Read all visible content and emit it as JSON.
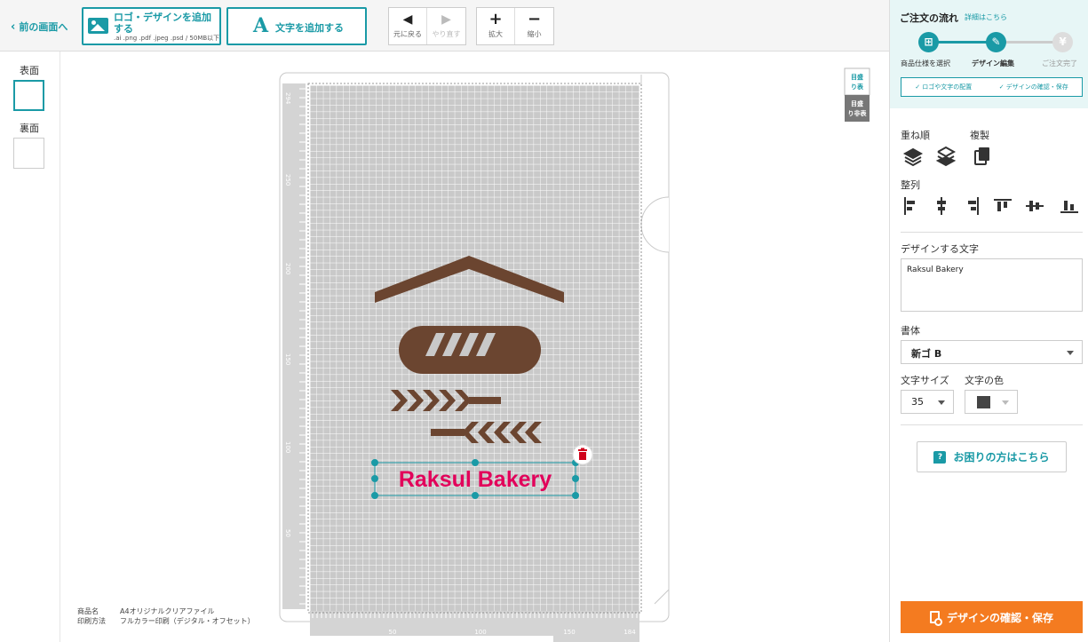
{
  "toolbar": {
    "back_label": "前の画面へ",
    "logo_button": {
      "line1": "ロゴ・デザインを追加する",
      "formats": ".ai .png .pdf .jpeg .psd / 50MB以下"
    },
    "text_button": {
      "icon": "A",
      "label": "文字を追加する"
    },
    "undo": "元に戻る",
    "redo": "やり直す",
    "zoom_in": "拡大",
    "zoom_out": "縮小"
  },
  "sides": {
    "front": "表面",
    "back": "裏面"
  },
  "canvas": {
    "ruler_v": [
      "294",
      "250",
      "200",
      "150",
      "100",
      "50"
    ],
    "ruler_h": [
      "50",
      "100",
      "150",
      "184"
    ],
    "guide_show": "目盛り表示",
    "guide_hide": "目盛り非表示",
    "selected_text": "Raksul Bakery",
    "selected_text_color": "#e2005a"
  },
  "product": {
    "name_label": "商品名",
    "name_value": "A4オリジナルクリアファイル",
    "print_label": "印刷方法",
    "print_value": "フルカラー印刷（デジタル・オフセット）"
  },
  "panel": {
    "flow_title": "ご注文の流れ",
    "flow_detail": "詳細はこちら",
    "steps": [
      {
        "label": "商品仕様を選択",
        "icon": "gift-icon"
      },
      {
        "label": "デザイン編集",
        "icon": "pencil-icon"
      },
      {
        "label": "ご注文完了",
        "icon": "yen-icon"
      }
    ],
    "substeps": [
      "✓ ロゴや文字の配置",
      "✓ デザインの確認・保存"
    ],
    "order_label": "重ね順",
    "duplicate_label": "複製",
    "align_label": "整列",
    "text_label": "デザインする文字",
    "text_value": "Raksul Bakery",
    "font_label": "書体",
    "font_value": "新ゴ B",
    "size_label": "文字サイズ",
    "size_value": "35",
    "color_label": "文字の色",
    "color_value": "#444444",
    "help_button": "お困りの方はこちら",
    "save_button": "デザインの確認・保存"
  },
  "colors": {
    "accent": "#1a9aa6",
    "brown": "#6b4530",
    "cta": "#f47b20"
  }
}
